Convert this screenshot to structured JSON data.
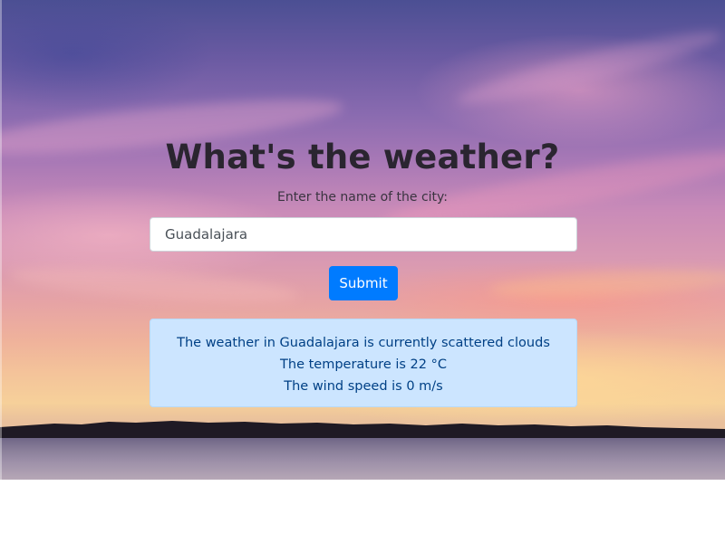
{
  "page": {
    "title": "What's the weather?",
    "prompt": "Enter the name of the city:"
  },
  "form": {
    "city_value": "Guadalajara",
    "submit_label": "Submit"
  },
  "result": {
    "lines": [
      "The weather in Guadalajara is currently scattered clouds",
      "The temperature is 22 °C",
      "The wind speed is 0 m/s"
    ]
  },
  "colors": {
    "accent": "#007bff",
    "alert_background": "#cce5ff",
    "alert_text": "#004085",
    "title_text": "#2a2530"
  },
  "background": {
    "icon": "sunset-lake-photo"
  }
}
